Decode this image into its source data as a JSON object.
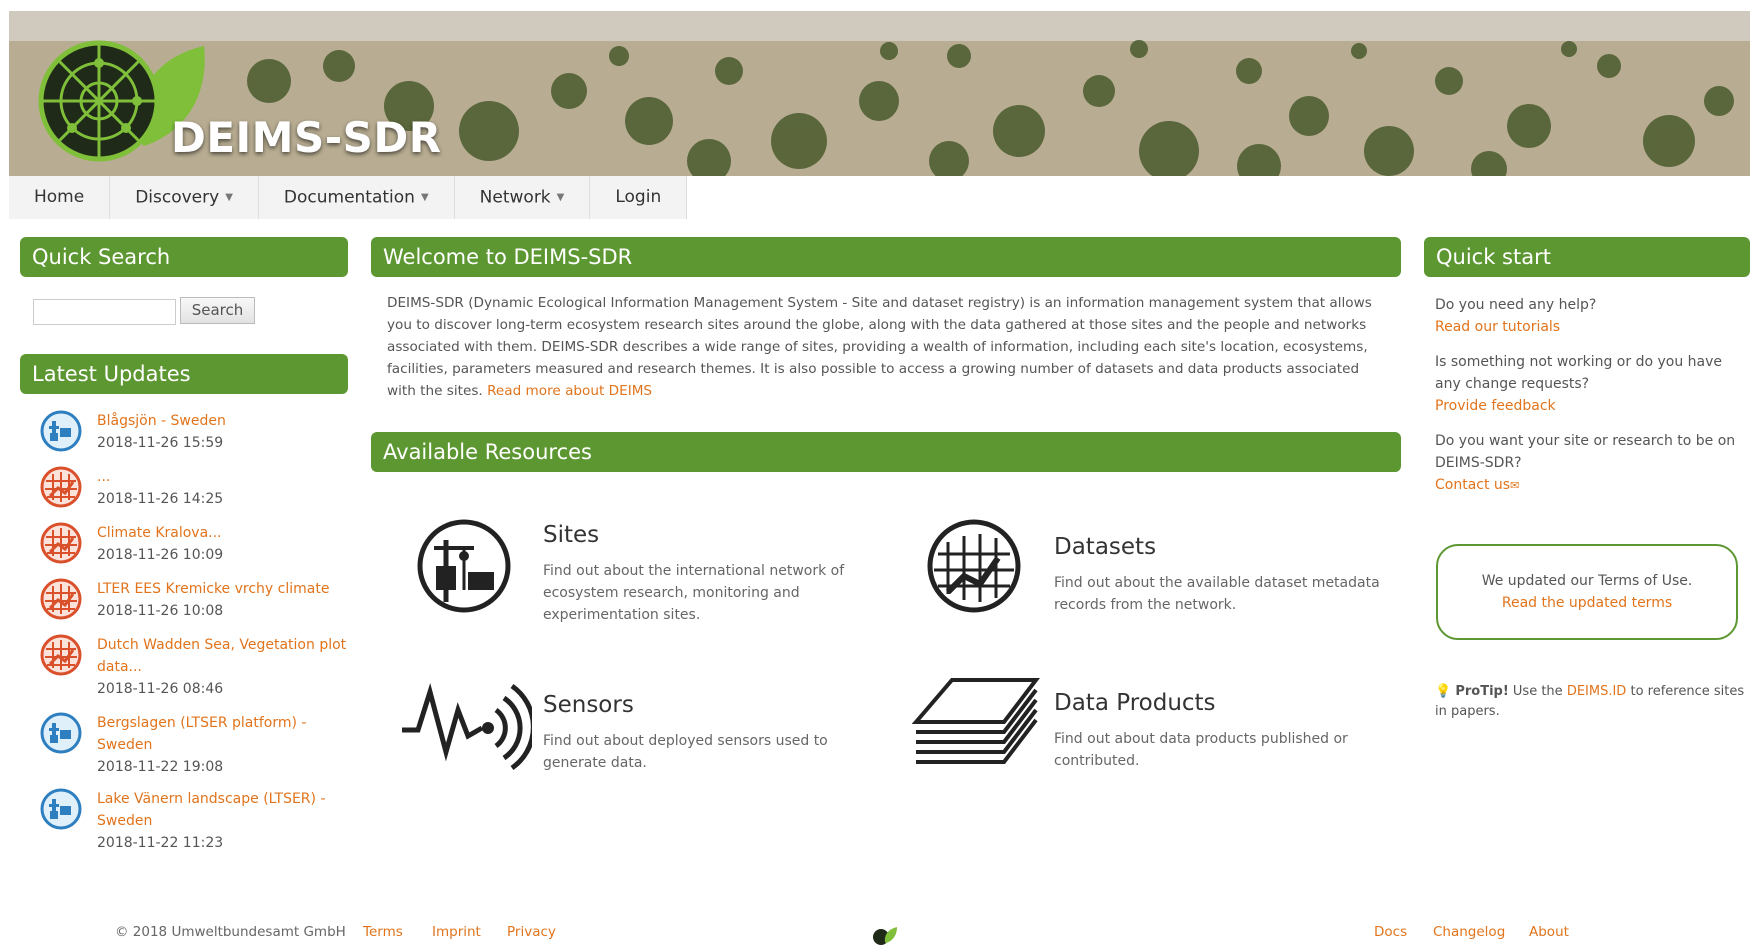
{
  "brand": {
    "name": "DEIMS-SDR"
  },
  "nav": [
    {
      "label": "Home",
      "caret": false
    },
    {
      "label": "Discovery",
      "caret": true
    },
    {
      "label": "Documentation",
      "caret": true
    },
    {
      "label": "Network",
      "caret": true
    },
    {
      "label": "Login",
      "caret": false
    }
  ],
  "quick_search": {
    "title": "Quick Search",
    "button": "Search",
    "value": ""
  },
  "latest_updates": {
    "title": "Latest Updates",
    "items": [
      {
        "icon": "site-icon",
        "title": "Blågsjön - Sweden",
        "date": "2018-11-26 15:59"
      },
      {
        "icon": "dataset-icon",
        "title": "...",
        "date": "2018-11-26 14:25"
      },
      {
        "icon": "dataset-icon",
        "title": "Climate Kralova...",
        "date": "2018-11-26 10:09"
      },
      {
        "icon": "dataset-icon",
        "title": "LTER EES Kremicke vrchy climate",
        "date": "2018-11-26 10:08"
      },
      {
        "icon": "dataset-icon",
        "title": "Dutch Wadden Sea, Vegetation plot data...",
        "date": "2018-11-26 08:46"
      },
      {
        "icon": "site-icon",
        "title": "Bergslagen (LTSER platform) - Sweden",
        "date": "2018-11-22 19:08"
      },
      {
        "icon": "site-icon",
        "title": "Lake Vänern landscape (LTSER) - Sweden",
        "date": "2018-11-22 11:23"
      }
    ]
  },
  "welcome": {
    "title": "Welcome to DEIMS-SDR",
    "body": "DEIMS-SDR (Dynamic Ecological Information Management System - Site and dataset registry) is an information management system that allows you to discover long-term ecosystem research sites around the globe, along with the data gathered at those sites and the people and networks associated with them. DEIMS-SDR describes a wide range of sites, providing a wealth of information, including each site's location, ecosystems, facilities, parameters measured and research themes. It is also possible to access a growing number of datasets and data products associated with the sites.",
    "link": "Read more about DEIMS"
  },
  "resources": {
    "title": "Available Resources",
    "sites": {
      "title": "Sites",
      "desc": "Find out about the international network of ecosystem research, monitoring and experimentation sites."
    },
    "datasets": {
      "title": "Datasets",
      "desc": "Find out about the available dataset metadata records from the network."
    },
    "sensors": {
      "title": "Sensors",
      "desc": "Find out about deployed sensors used to generate data."
    },
    "data_products": {
      "title": "Data Products",
      "desc": "Find out about data products published or contributed."
    }
  },
  "quick_start": {
    "title": "Quick start",
    "q1": "Do you need any help?",
    "l1": "Read our tutorials",
    "q2": "Is something not working or do you have any change requests?",
    "l2": "Provide feedback",
    "q3": "Do you want your site or research to be on DEIMS-SDR?",
    "l3": "Contact us",
    "terms_text": "We updated our Terms of Use.",
    "terms_link": "Read the updated terms",
    "protip_label": "ProTip!",
    "protip_pre": "Use the",
    "protip_link": "DEIMS.ID",
    "protip_post": "to reference sites in papers."
  },
  "footer": {
    "copyright": "© 2018 Umweltbundesamt GmbH",
    "left_links": [
      "Terms",
      "Imprint",
      "Privacy"
    ],
    "right_links": [
      "Docs",
      "Changelog",
      "About"
    ]
  },
  "colors": {
    "accent_green": "#5d9732",
    "link_orange": "#e1741c",
    "site_icon_blue": "#2e7fc0",
    "dataset_icon_orange": "#d9502a"
  }
}
